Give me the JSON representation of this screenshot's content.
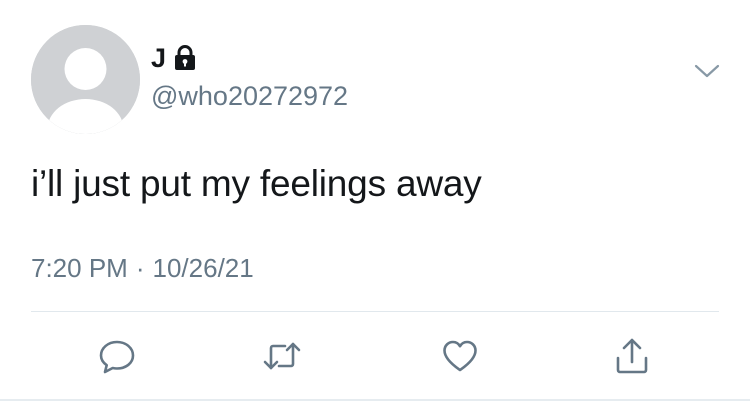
{
  "tweet": {
    "author": {
      "display_name": "J",
      "handle": "@who20272972",
      "protected_icon": "lock-icon"
    },
    "text": "i’ll just put my feelings away",
    "time": "7:20 PM",
    "separator": "·",
    "date": "10/26/21"
  },
  "actions": [
    {
      "icon": "reply-icon"
    },
    {
      "icon": "retweet-icon"
    },
    {
      "icon": "like-icon"
    },
    {
      "icon": "share-icon"
    }
  ],
  "colors": {
    "text": "#14171a",
    "secondary": "#657786",
    "avatar_bg": "#cfd1d4",
    "divider": "#e1e8ed"
  }
}
